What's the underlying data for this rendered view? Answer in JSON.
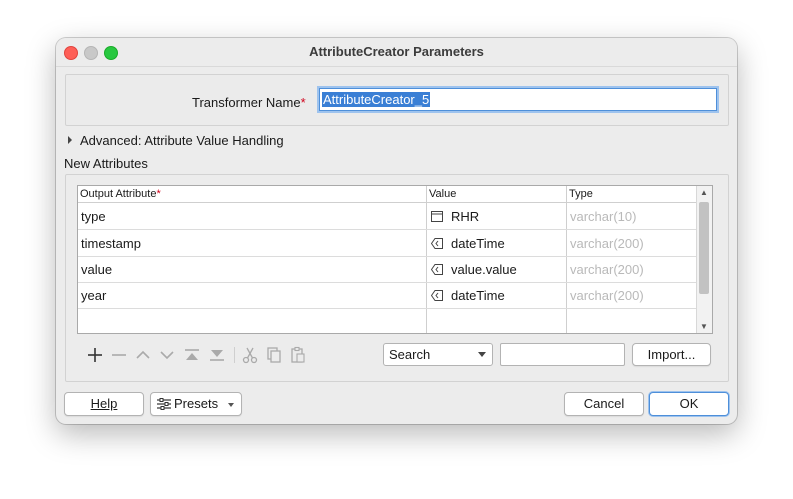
{
  "window": {
    "title": "AttributeCreator Parameters"
  },
  "transformer": {
    "label": "Transformer Name",
    "required_mark": "*",
    "value": "AttributeCreator_5"
  },
  "advanced": {
    "label": "Advanced: Attribute Value Handling"
  },
  "new_attributes": {
    "label": "New Attributes",
    "columns": {
      "output": "Output Attribute",
      "output_required": "*",
      "value": "Value",
      "type": "Type"
    },
    "rows": [
      {
        "output": "type",
        "value_icon": "constant-icon",
        "value": "RHR",
        "type": "varchar(10)"
      },
      {
        "output": "timestamp",
        "value_icon": "attribute-value-icon",
        "value": "dateTime",
        "type": "varchar(200)"
      },
      {
        "output": "value",
        "value_icon": "attribute-value-icon",
        "value": "value.value",
        "type": "varchar(200)"
      },
      {
        "output": "year",
        "value_icon": "attribute-value-icon",
        "value": "dateTime",
        "type": "varchar(200)"
      }
    ]
  },
  "toolbar": {
    "icons": [
      "add-icon",
      "remove-icon",
      "move-up-icon",
      "move-down-icon",
      "move-top-icon",
      "move-bottom-icon",
      "cut-icon",
      "copy-icon",
      "paste-icon"
    ],
    "search_select": "Search",
    "search_value": "",
    "import_label": "Import..."
  },
  "footer": {
    "help": "Help",
    "presets": "Presets",
    "cancel": "Cancel",
    "ok": "OK"
  },
  "colors": {
    "accent": "#3a7fd5",
    "required": "#d0021b",
    "type_text": "#b9b9b9"
  }
}
